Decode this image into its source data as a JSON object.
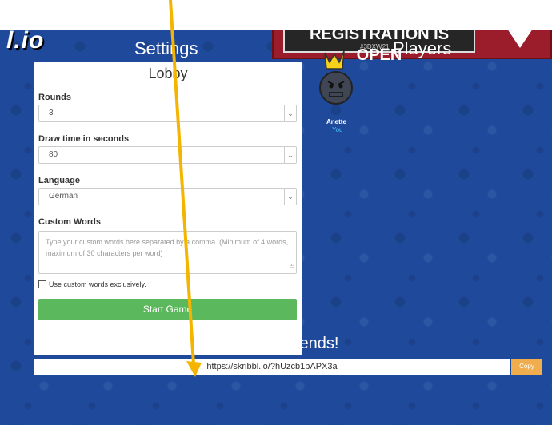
{
  "header": {
    "logo_text": "l.io",
    "banner_text": "REGISTRATION IS OPEN",
    "banner_subtext": "#3DXW21"
  },
  "settings": {
    "heading": "Settings",
    "panel_title": "Lobby",
    "rounds": {
      "label": "Rounds",
      "value": "3"
    },
    "draw_time": {
      "label": "Draw time in seconds",
      "value": "80"
    },
    "language": {
      "label": "Language",
      "value": "German"
    },
    "custom_words": {
      "label": "Custom Words",
      "placeholder": "Type your custom words here separated by a comma. (Minimum of 4 words, maximum of 30 characters per word)"
    },
    "exclusive_label": "Use custom words exclusively.",
    "start_button": "Start Game"
  },
  "players": {
    "heading": "Players",
    "list": [
      {
        "name": "Anette",
        "tag": "You"
      }
    ]
  },
  "invite": {
    "heading": "Invite your friends!",
    "url": "https://skribbl.io/?hUzcb1bAPX3a",
    "copy_button": "Copy"
  },
  "colors": {
    "background": "#1f4a9c",
    "start_button": "#5cb85c",
    "copy_button": "#f0ad4e",
    "annotation_arrow": "#f5b400",
    "you_tag": "#4fc3f7"
  },
  "icons": {
    "avatar": "crowned-avatar-icon",
    "select_arrow": "chevron-down-icon"
  }
}
